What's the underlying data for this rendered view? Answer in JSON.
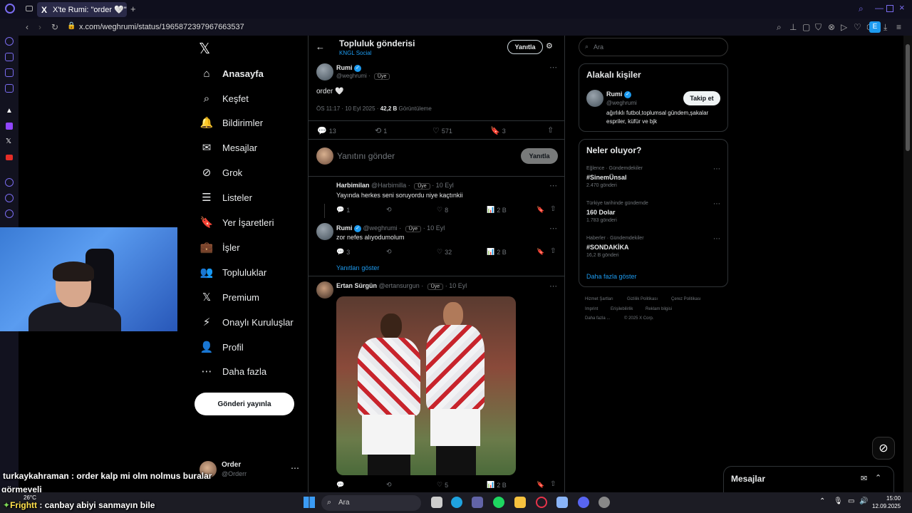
{
  "browser": {
    "tab_title": "X'te Rumi: \"order 🤍\" / X",
    "tab_icon": "X",
    "url": "x.com/weghrumi/status/1965872397967663537",
    "new_tab": "+"
  },
  "nav": {
    "logo": "𝕏",
    "items": [
      {
        "label": "Anasayfa",
        "icon": "⌂"
      },
      {
        "label": "Keşfet",
        "icon": "⌕"
      },
      {
        "label": "Bildirimler",
        "icon": "🔔"
      },
      {
        "label": "Mesajlar",
        "icon": "✉"
      },
      {
        "label": "Grok",
        "icon": "⊘"
      },
      {
        "label": "Listeler",
        "icon": "☰"
      },
      {
        "label": "Yer İşaretleri",
        "icon": "🔖"
      },
      {
        "label": "İşler",
        "icon": "💼"
      },
      {
        "label": "Topluluklar",
        "icon": "👥"
      },
      {
        "label": "Premium",
        "icon": "𝕏"
      },
      {
        "label": "Onaylı Kuruluşlar",
        "icon": "⚡"
      },
      {
        "label": "Profil",
        "icon": "👤"
      },
      {
        "label": "Daha fazla",
        "icon": "⋯"
      }
    ],
    "post_button": "Gönderi yayınla",
    "account_name": "Order",
    "account_handle": "@Orderr",
    "account_more": "⋯"
  },
  "header": {
    "back": "←",
    "title": "Topluluk gönderisi",
    "subtitle": "KNGL Social",
    "reply_button": "Yanıtla",
    "filter_icon": "⚙"
  },
  "main_post": {
    "name": "Rumi",
    "handle": "@weghrumi",
    "badge": "Üye",
    "text": "order 🤍",
    "time": "ÖS 11:17 · 10 Eyl 2025 ·",
    "views": "42,2 B",
    "views_label": "Görüntüleme",
    "replies": "13",
    "reposts": "1",
    "likes": "571",
    "bookmarks": "3",
    "more": "⋯"
  },
  "reply_box": {
    "placeholder": "Yanıtını gönder",
    "button": "Yanıtla"
  },
  "replies": [
    {
      "name": "Harbimilan",
      "handle": "@Harbimilla",
      "badge": "Üye",
      "date": "· 10 Eyl",
      "text": "Yayında herkes seni soruyordu niye kaçtınkii",
      "replies": "1",
      "likes": "8",
      "views": "2 B"
    },
    {
      "name": "Rumi",
      "handle": "@weghrumi",
      "badge": "Üye",
      "date": "· 10 Eyl",
      "text": "zor nefes alıyodumolum",
      "replies": "3",
      "likes": "32",
      "views": "2 B"
    }
  ],
  "show_replies": "Yanıtları göster",
  "third_post": {
    "name": "Ertan Sürgün",
    "handle": "@ertansurgun",
    "badge": "Üye",
    "date": "· 10 Eyl",
    "likes": "5",
    "views": "2 B"
  },
  "right": {
    "search_placeholder": "Ara",
    "related_title": "Alakalı kişiler",
    "related_name": "Rumi",
    "related_handle": "@weghrumi",
    "related_bio": "ağırlıklı futbol,toplumsal gündem,şakalar espriler, küfür ve bjk",
    "follow_button": "Takip et",
    "trends_title": "Neler oluyor?",
    "trends": [
      {
        "category": "Eğlence · Gündemdekiler",
        "name": "#SinemÜnsal",
        "count": "2.470 gönderi"
      },
      {
        "category": "Türkiye tarihinde gündemde",
        "name": "160 Dolar",
        "count": "1.783 gönderi"
      },
      {
        "category": "Haberler · Gündemdekiler",
        "name": "#SONDAKİKA",
        "count": "16,2 B gönderi"
      }
    ],
    "show_more": "Daha fazla göster",
    "footer": [
      "Hizmet Şartları",
      "Gizlilik Politikası",
      "Çerez Politikası",
      "Imprint",
      "Erişilebilirlik",
      "Reklam bilgisi",
      "Daha fazla ...",
      "© 2025 X Corp."
    ],
    "messages_title": "Mesajlar"
  },
  "stream": {
    "chat": [
      {
        "user": "turkaykahraman",
        "text": " : order kalp mi olm nolmus buralar"
      },
      {
        "user": "",
        "text": "görmeyeli"
      },
      {
        "user": "Frightt",
        "text": " : canbay abiyi sanmayın bile"
      }
    ],
    "weather": "26°C"
  },
  "taskbar": {
    "search": "Ara",
    "time": "15:00",
    "date": "12.09.2025"
  }
}
